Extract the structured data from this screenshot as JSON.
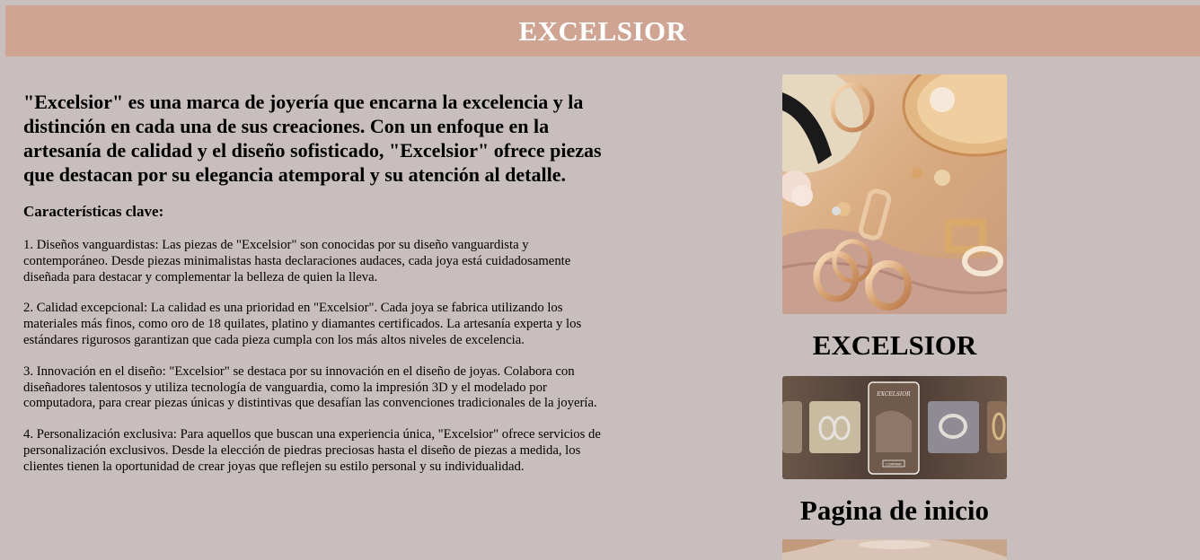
{
  "header": {
    "title": "EXCELSIOR"
  },
  "main": {
    "intro": "\"Excelsior\" es una marca de joyería que encarna la excelencia y la distinción en cada una de sus creaciones. Con un enfoque en la artesanía de calidad y el diseño sofisticado, \"Excelsior\" ofrece piezas que destacan por su elegancia atemporal y su atención al detalle.",
    "features_heading": "Características clave:",
    "paragraphs": [
      "1. Diseños vanguardistas: Las piezas de \"Excelsior\" son conocidas por su diseño vanguardista y contemporáneo. Desde piezas minimalistas hasta declaraciones audaces, cada joya está cuidadosamente diseñada para destacar y complementar la belleza de quien la lleva.",
      "2. Calidad excepcional: La calidad es una prioridad en \"Excelsior\". Cada joya se fabrica utilizando los materiales más finos, como oro de 18 quilates, platino y diamantes certificados. La artesanía experta y los estándares rigurosos garantizan que cada pieza cumpla con los más altos niveles de excelencia.",
      "3. Innovación en el diseño: \"Excelsior\" se destaca por su innovación en el diseño de joyas. Colabora con diseñadores talentosos y utiliza tecnología de vanguardia, como la impresión 3D y el modelado por computadora, para crear piezas únicas y distintivas que desafían las convenciones tradicionales de la joyería.",
      "4. Personalización exclusiva: Para aquellos que buscan una experiencia única, \"Excelsior\" ofrece servicios de personalización exclusivos. Desde la elección de piedras preciosas hasta el diseño de piezas a medida, los clientes tienen la oportunidad de crear joyas que reflejen su estilo personal y su individualidad."
    ]
  },
  "sidebar": {
    "caption_1": "EXCELSIOR",
    "caption_2": "Pagina de inicio",
    "phone_brand": "EXCELSIOR",
    "phone_button": "COMPRAR"
  },
  "colors": {
    "background": "#c8bebe",
    "header_bg": "#cfa492",
    "header_text": "#ffffff"
  }
}
